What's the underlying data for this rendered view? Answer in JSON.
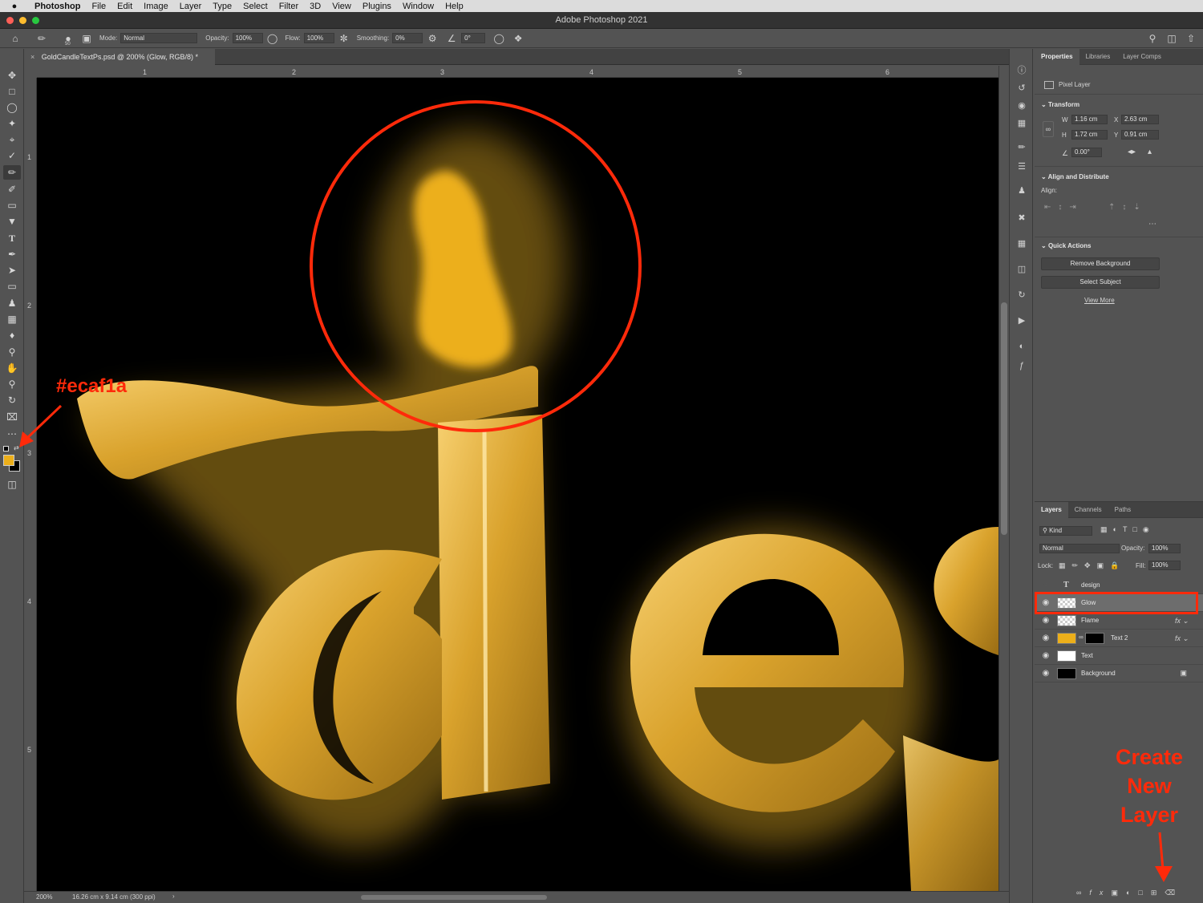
{
  "menubar": {
    "app": "Photoshop",
    "items": [
      "File",
      "Edit",
      "Image",
      "Layer",
      "Type",
      "Select",
      "Filter",
      "3D",
      "View",
      "Plugins",
      "Window",
      "Help"
    ]
  },
  "window": {
    "title": "Adobe Photoshop 2021"
  },
  "options": {
    "brush_size": "50",
    "mode_label": "Mode:",
    "mode_value": "Normal",
    "opacity_label": "Opacity:",
    "opacity_value": "100%",
    "flow_label": "Flow:",
    "flow_value": "100%",
    "smoothing_label": "Smoothing:",
    "smoothing_value": "0%",
    "angle_value": "0°"
  },
  "document": {
    "tab_title": "GoldCandleTextPs.psd @ 200% (Glow, RGB/8) *"
  },
  "rulers": {
    "top": [
      "1",
      "2",
      "3",
      "4",
      "5",
      "6"
    ],
    "left": [
      "1",
      "2",
      "3",
      "4",
      "5"
    ]
  },
  "status": {
    "zoom": "200%",
    "doc_size": "16.26 cm x 9.14 cm (300 ppi)"
  },
  "colors": {
    "foreground": "#ecaf1a",
    "background": "#000000",
    "annotation": "#ff2a0a"
  },
  "properties": {
    "tabs": [
      "Properties",
      "Libraries",
      "Layer Comps"
    ],
    "kind": "Pixel Layer",
    "transform": {
      "title": "Transform",
      "w_label": "W",
      "w": "1.16 cm",
      "x_label": "X",
      "x": "2.63 cm",
      "h_label": "H",
      "h": "1.72 cm",
      "y_label": "Y",
      "y": "0.91 cm",
      "angle": "0.00°"
    },
    "align": {
      "title": "Align and Distribute",
      "label": "Align:"
    },
    "quick": {
      "title": "Quick Actions",
      "remove_bg": "Remove Background",
      "select_subject": "Select Subject",
      "view_more": "View More"
    }
  },
  "layers_panel": {
    "tabs": [
      "Layers",
      "Channels",
      "Paths"
    ],
    "filter": "Kind",
    "blend": "Normal",
    "opacity_label": "Opacity:",
    "opacity": "100%",
    "lock_label": "Lock:",
    "fill_label": "Fill:",
    "fill": "100%",
    "layers": [
      {
        "name": "design",
        "type": "text",
        "visible": false
      },
      {
        "name": "Glow",
        "type": "pixel",
        "visible": true,
        "selected": true
      },
      {
        "name": "Flame",
        "type": "pixel",
        "visible": true,
        "fx": true
      },
      {
        "name": "Text 2",
        "type": "fill",
        "visible": true,
        "fx": true
      },
      {
        "name": "Text",
        "type": "pixel",
        "visible": true
      },
      {
        "name": "Background",
        "type": "background",
        "visible": true,
        "locked": true
      }
    ]
  },
  "annotations": {
    "color_label": "#ecaf1a",
    "create_layer": [
      "Create",
      "New",
      "Layer"
    ]
  }
}
